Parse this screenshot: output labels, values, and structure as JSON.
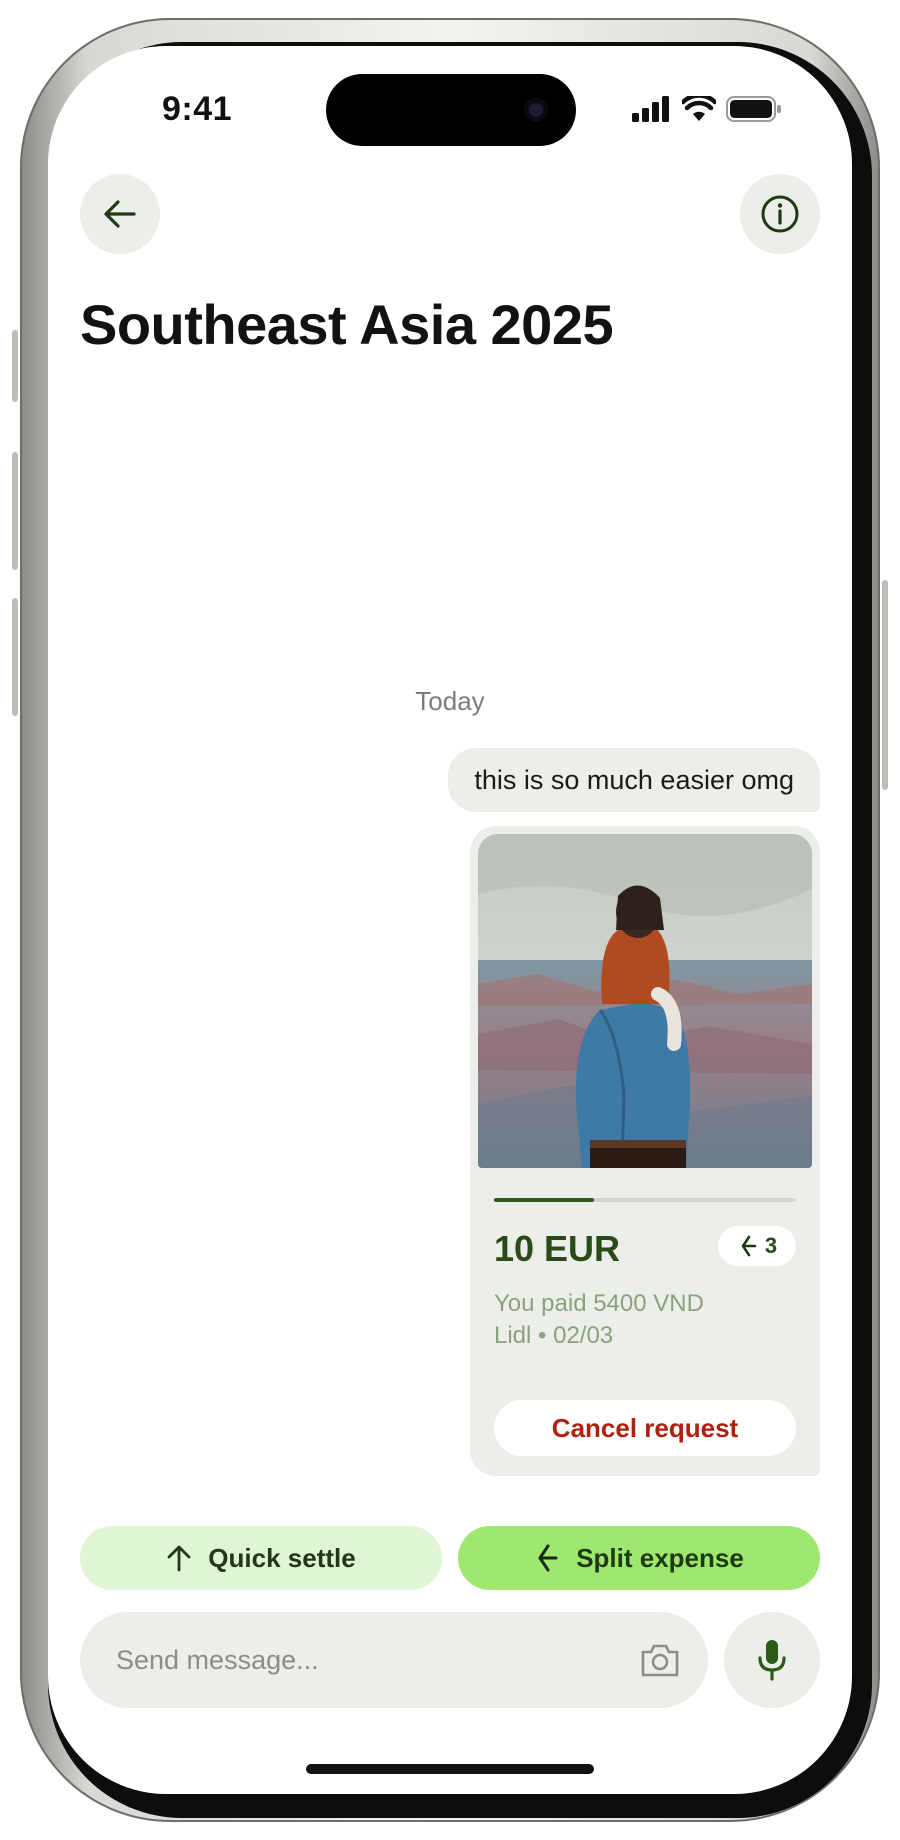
{
  "status_bar": {
    "time": "9:41"
  },
  "header": {
    "title": "Southeast Asia 2025"
  },
  "chat": {
    "day_label": "Today",
    "message_text": "this is so much easier omg",
    "expense_card": {
      "amount": "10 EUR",
      "split_count": "3",
      "paid_text": "You paid 5400 VND",
      "merchant_date": "Lidl • 02/03",
      "cancel_label": "Cancel request",
      "progress_fraction": 0.33
    }
  },
  "actions": {
    "quick_settle_label": "Quick settle",
    "split_expense_label": "Split expense"
  },
  "composer": {
    "placeholder": "Send message..."
  },
  "colors": {
    "accent_green": "#9ee870",
    "light_green": "#dff5d4",
    "dark_green": "#2a4a17",
    "cancel_red": "#b0200e",
    "surface_gray": "#eceeea"
  },
  "icons": {
    "back": "arrow-left-icon",
    "info": "info-icon",
    "split": "split-icon",
    "settle": "arrow-up-icon",
    "camera": "camera-icon",
    "mic": "microphone-icon"
  }
}
